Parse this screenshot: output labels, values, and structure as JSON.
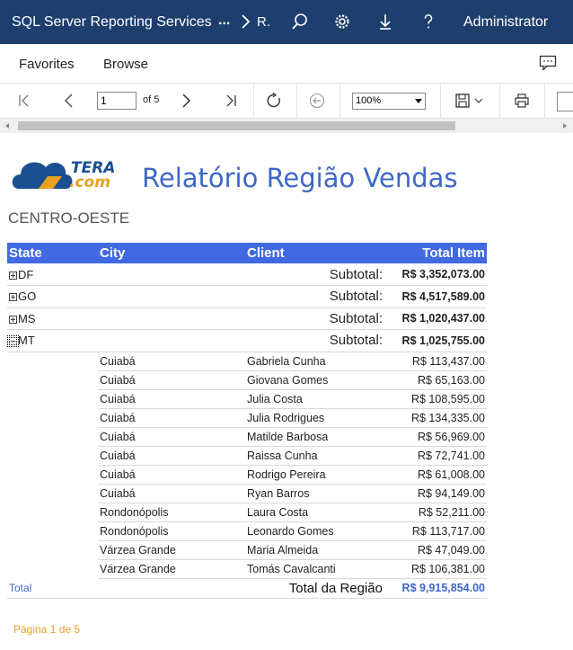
{
  "app": {
    "title": "SQL Server Reporting Services",
    "breadcrumb_ellipsis": "...",
    "breadcrumb_current": "R.",
    "user": "Administrator"
  },
  "nav": {
    "favorites": "Favorites",
    "browse": "Browse"
  },
  "toolbar": {
    "page_value": "1",
    "of_label": "of 5",
    "zoom": "100%"
  },
  "report": {
    "logo_text_top": "TERA",
    "logo_text_bottom": ".com",
    "title": "Relatório Região Vendas",
    "region": "CENTRO-OESTE",
    "columns": [
      "State",
      "City",
      "Client",
      "Total Item"
    ],
    "subtotal_label": "Subtotal:",
    "subtotals": [
      {
        "state": "DF",
        "amount": "R$ 3,352,073.00",
        "expanded": false
      },
      {
        "state": "GO",
        "amount": "R$ 4,517,589.00",
        "expanded": false
      },
      {
        "state": "MS",
        "amount": "R$ 1,020,437.00",
        "expanded": false
      },
      {
        "state": "MT",
        "amount": "R$ 1,025,755.00",
        "expanded": true
      }
    ],
    "rows": [
      {
        "city": "Cuiabá",
        "client": "Gabriela Cunha",
        "total": "R$ 113,437.00"
      },
      {
        "city": "Cuiabá",
        "client": "Giovana Gomes",
        "total": "R$ 65,163.00"
      },
      {
        "city": "Cuiabá",
        "client": "Julia Costa",
        "total": "R$ 108,595.00"
      },
      {
        "city": "Cuiabá",
        "client": "Julia Rodrigues",
        "total": "R$ 134,335.00"
      },
      {
        "city": "Cuiabá",
        "client": "Matilde Barbosa",
        "total": "R$ 56,969.00"
      },
      {
        "city": "Cuiabá",
        "client": "Raissa Cunha",
        "total": "R$ 72,741.00"
      },
      {
        "city": "Cuiabá",
        "client": "Rodrigo Pereira",
        "total": "R$ 61,008.00"
      },
      {
        "city": "Cuiabá",
        "client": "Ryan Barros",
        "total": "R$ 94,149.00"
      },
      {
        "city": "Rondonópolis",
        "client": "Laura Costa",
        "total": "R$ 52,211.00"
      },
      {
        "city": "Rondonópolis",
        "client": "Leonardo Gomes",
        "total": "R$ 113,717.00"
      },
      {
        "city": "Várzea Grande",
        "client": "Maria Almeida",
        "total": "R$ 47,049.00"
      },
      {
        "city": "Várzea Grande",
        "client": "Tomás Cavalcanti",
        "total": "R$ 106,381.00"
      }
    ],
    "total_label": "Total",
    "total_region_label": "Total da Região",
    "total_region_amount": "R$ 9,915,854.00",
    "footer": "Página 1 de 5"
  },
  "colors": {
    "topbar": "#1e3f6e",
    "header_blue": "#4169e1",
    "title_blue": "#3d68c9",
    "footer_orange": "#e8a020"
  }
}
